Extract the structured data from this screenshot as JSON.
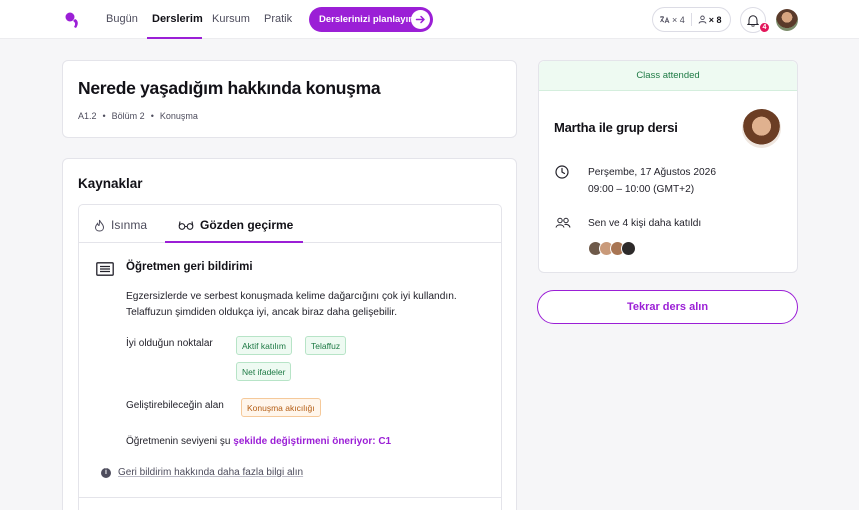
{
  "nav": {
    "items": [
      "Bugün",
      "Derslerim",
      "Kursum",
      "Pratik"
    ],
    "active_index": 1,
    "plan_button": "Derslerinizi planlayın",
    "stat1_icon": "translate-icon",
    "stat1_value": "× 4",
    "stat2_icon": "person-icon",
    "stat2_value": "× 8",
    "notification_count": "4"
  },
  "lesson": {
    "title": "Nerede yaşadığım hakkında konuşma",
    "breadcrumb": [
      "A1.2",
      "Bölüm 2",
      "Konuşma"
    ]
  },
  "resources": {
    "title": "Kaynaklar",
    "tabs": [
      "Isınma",
      "Gözden geçirme"
    ],
    "active_tab": 1,
    "feedback": {
      "title": "Öğretmen geri bildirimi",
      "text": "Egzersizlerde ve serbest konuşmada kelime dağarcığını çok iyi kullandın. Telaffuzun şimdiden oldukça iyi, ancak biraz daha gelişebilir.",
      "strengths_label": "İyi olduğun noktalar",
      "strengths": [
        "Aktif katılım",
        "Telaffuz",
        "Net ifadeler"
      ],
      "improve_label": "Geliştirebileceğin alan",
      "improve": [
        "Konuşma akıcılığı"
      ],
      "level_prefix": "Öğretmenin seviyeni şu ",
      "level_link": "şekilde değiştirmeni öneriyor: C1",
      "more_info": "Geri bildirim hakkında daha fazla bilgi alın"
    }
  },
  "side": {
    "status": "Class attended",
    "title": "Martha ile grup dersi",
    "date": "Perşembe, 17 Ağustos 2026",
    "time": "09:00 – 10:00 (GMT+2)",
    "attendees": "Sen ve 4 kişi daha katıldı",
    "retake_button": "Tekrar ders alın"
  },
  "colors": {
    "accent": "#9b1fd6",
    "success": "#1e7a45",
    "warning": "#b35c12",
    "badge": "#e3175b"
  }
}
